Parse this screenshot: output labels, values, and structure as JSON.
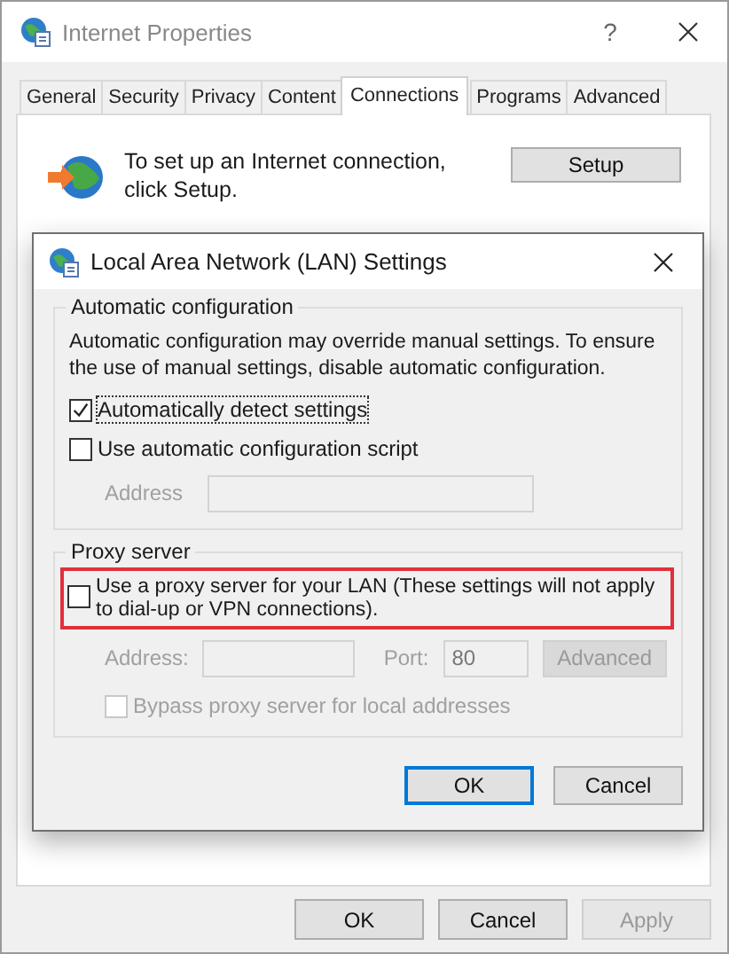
{
  "window": {
    "title": "Internet Properties",
    "help": "?"
  },
  "tabs": [
    {
      "label": "General",
      "selected": false
    },
    {
      "label": "Security",
      "selected": false
    },
    {
      "label": "Privacy",
      "selected": false
    },
    {
      "label": "Content",
      "selected": false
    },
    {
      "label": "Connections",
      "selected": true
    },
    {
      "label": "Programs",
      "selected": false
    },
    {
      "label": "Advanced",
      "selected": false
    }
  ],
  "setup": {
    "text": "To set up an Internet connection, click Setup.",
    "button": "Setup"
  },
  "lan_dialog": {
    "title": "Local Area Network (LAN) Settings",
    "automatic": {
      "heading": "Automatic configuration",
      "description": "Automatic configuration may override manual settings.  To ensure the use of manual settings, disable automatic configuration.",
      "options": [
        {
          "label": "Automatically detect settings",
          "checked": true,
          "focused": true
        },
        {
          "label": "Use automatic configuration script",
          "checked": false,
          "focused": false
        }
      ],
      "address": {
        "label": "Address",
        "disabled": true
      }
    },
    "proxy": {
      "heading": "Proxy server",
      "use_proxy": {
        "label": "Use a proxy server for your LAN (These settings will not apply to dial-up or VPN connections).",
        "checked": false,
        "highlighted": true
      },
      "address": {
        "label": "Address:",
        "disabled": true
      },
      "port": {
        "label": "Port:",
        "value": "80",
        "disabled": true
      },
      "advanced": {
        "label": "Advanced",
        "disabled": true
      },
      "bypass": {
        "label": "Bypass proxy server for local addresses",
        "checked": false,
        "disabled": true
      }
    },
    "buttons": [
      {
        "label": "OK",
        "default": true
      },
      {
        "label": "Cancel",
        "default": false
      }
    ]
  },
  "buttons": [
    {
      "label": "OK",
      "disabled": false
    },
    {
      "label": "Cancel",
      "disabled": false
    },
    {
      "label": "Apply",
      "disabled": true
    }
  ]
}
